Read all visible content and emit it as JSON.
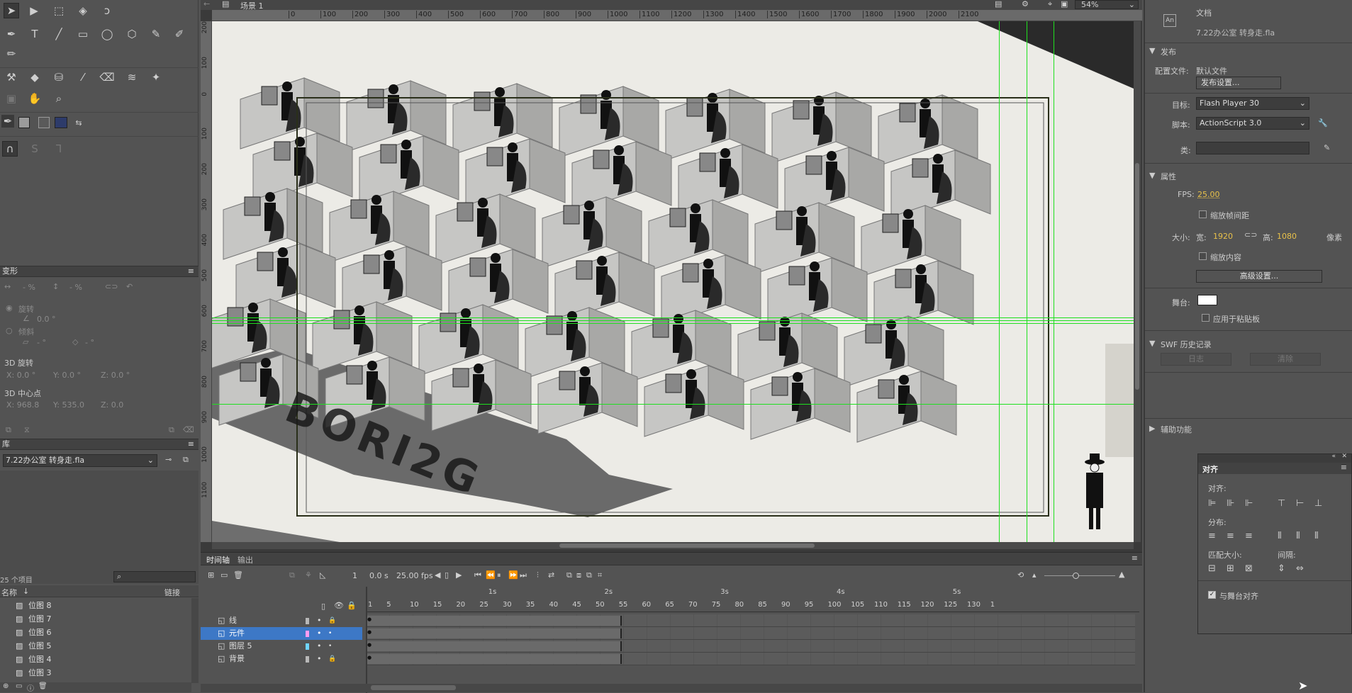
{
  "toolbar": {
    "icons": [
      "selection-arrow-icon",
      "subselection-icon",
      "free-transform-icon",
      "3d-rotation-icon",
      "lasso-icon",
      "pen-icon",
      "text-icon",
      "line-icon",
      "rectangle-icon",
      "oval-icon",
      "polystar-icon",
      "pencil-icon",
      "brush-icon",
      "paintbrush-icon",
      "bone-icon",
      "paint-bucket-icon",
      "ink-bottle-icon",
      "eyedropper-icon",
      "eraser-icon",
      "width-icon",
      "asset-warp-icon",
      "camera-icon",
      "hand-icon",
      "zoom-icon"
    ]
  },
  "stage_header": {
    "scene": "场景 1",
    "zoom": "54%"
  },
  "ruler_top": [
    "0",
    "100",
    "200",
    "300",
    "400",
    "500",
    "600",
    "700",
    "800",
    "900",
    "1000",
    "1100",
    "1200",
    "1300",
    "1400",
    "1500",
    "1600",
    "1700",
    "1800",
    "1900",
    "2000",
    "2100"
  ],
  "ruler_left": [
    "200",
    "100",
    "0",
    "100",
    "200",
    "300",
    "400",
    "500",
    "600",
    "700",
    "800",
    "900",
    "1000",
    "1100"
  ],
  "transform": {
    "title": "变形",
    "w": "- %",
    "h": "- %",
    "rotate_label": "旋转",
    "rotate_value": "0.0 °",
    "skew_label": "倾斜",
    "skew_x": "- °",
    "skew_y": "- °",
    "rot3d_label": "3D 旋转",
    "rot_x": "X: 0.0 °",
    "rot_y": "Y: 0.0 °",
    "rot_z": "Z: 0.0 °",
    "center3d_label": "3D 中心点",
    "cx": "X: 968.8",
    "cy": "Y: 535.0",
    "cz": "Z: 0.0"
  },
  "library": {
    "title": "库",
    "file": "7.22办公室 转身走.fla",
    "count": "25 个项目",
    "col_name": "名称",
    "col_link": "链接",
    "items": [
      "位图 8",
      "位图 7",
      "位图 6",
      "位图 5",
      "位图 4",
      "位图 3"
    ]
  },
  "properties": {
    "doc_label": "文档",
    "doc_name": "7.22办公室 转身走.fla",
    "publish_section": "发布",
    "profile_label": "配置文件:",
    "profile_value": "默认文件",
    "publish_settings": "发布设置...",
    "target_label": "目标:",
    "target_value": "Flash Player 30",
    "script_label": "脚本:",
    "script_value": "ActionScript 3.0",
    "class_label": "类:",
    "attrs_section": "属性",
    "fps_label": "FPS:",
    "fps_value": "25.00",
    "scale_spans": "缩放帧间距",
    "size_label": "大小:",
    "width_label": "宽:",
    "width_value": "1920",
    "height_label": "高:",
    "height_value": "1080",
    "unit": "像素",
    "scale_content": "缩放内容",
    "advanced": "高级设置...",
    "stage_label": "舞台:",
    "stage_color": "#ffffff",
    "apply_paste": "应用于粘贴板",
    "swf_section": "SWF 历史记录",
    "log_btn": "日志",
    "clear_btn": "清除",
    "access_section": "辅助功能"
  },
  "align": {
    "title": "对齐",
    "align_label": "对齐:",
    "dist_label": "分布:",
    "match_label": "匹配大小:",
    "space_label": "间隔:",
    "stage_align": "与舞台对齐"
  },
  "timeline": {
    "tab1": "时间轴",
    "tab2": "输出",
    "frame": "1",
    "time": "0.0 s",
    "fps": "25.00 fps",
    "sec_marks": [
      "1s",
      "2s",
      "3s",
      "4s",
      "5s"
    ],
    "frame_marks": [
      "1",
      "5",
      "10",
      "15",
      "20",
      "25",
      "30",
      "35",
      "40",
      "45",
      "50",
      "55",
      "60",
      "65",
      "70",
      "75",
      "80",
      "85",
      "90",
      "95",
      "100",
      "105",
      "110",
      "115",
      "120",
      "125",
      "130",
      "1"
    ],
    "layers": [
      {
        "name": "线",
        "color": "#b8b8b8",
        "selected": false
      },
      {
        "name": "元件",
        "color": "#ff9cf0",
        "selected": true
      },
      {
        "name": "图层 5",
        "color": "#6fd4ff",
        "selected": false
      },
      {
        "name": "背景",
        "color": "#b8b8b8",
        "selected": false
      }
    ]
  }
}
